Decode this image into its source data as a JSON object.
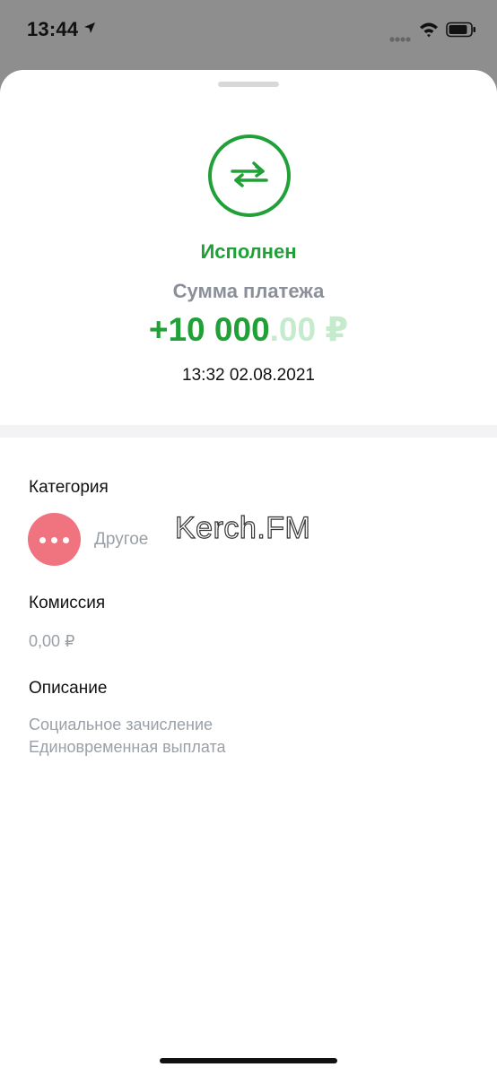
{
  "status_bar": {
    "time": "13:44",
    "icons": [
      "location-arrow-icon",
      "signal-icon",
      "wifi-icon",
      "battery-icon"
    ]
  },
  "payment": {
    "icon": "transfer-arrows-icon",
    "status": "Исполнен",
    "amount_caption": "Сумма платежа",
    "amount_integer": "+10 000",
    "amount_decimal": ".00",
    "currency": "₽",
    "datetime": "13:32 02.08.2021"
  },
  "details": {
    "category": {
      "label": "Категория",
      "value": "Другое",
      "icon": "more-dots-icon"
    },
    "commission": {
      "label": "Комиссия",
      "value": "0,00 ₽"
    },
    "description": {
      "label": "Описание",
      "line1": "Социальное зачисление",
      "line2": "Единовременная выплата"
    }
  },
  "watermark": "Kerch.FM",
  "colors": {
    "accent_green": "#21a038",
    "pale_green": "#c5ebcd",
    "category_pink": "#f07380",
    "muted_gray": "#9aa0a8",
    "backdrop": "#8e8e8e"
  }
}
